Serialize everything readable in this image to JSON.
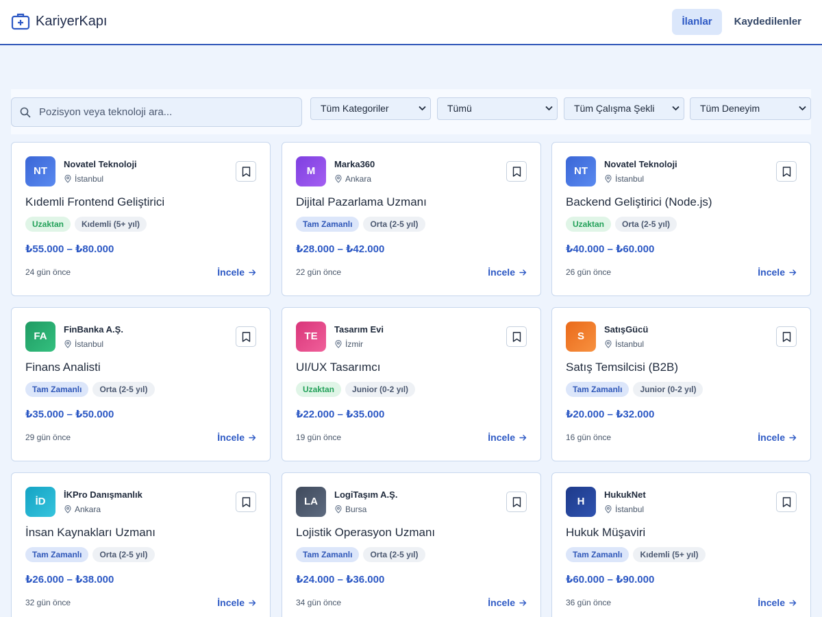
{
  "app": {
    "brand": "KariyerKapı",
    "nav": [
      {
        "label": "İlanlar",
        "active": true
      },
      {
        "label": "Kaydedilenler",
        "active": false
      }
    ]
  },
  "filters": {
    "search_placeholder": "Pozisyon veya teknoloji ara...",
    "search_value": "",
    "category": "Tüm Kategoriler",
    "type": "Tümü",
    "work_mode": "Tüm Çalışma Şekli",
    "experience": "Tüm Deneyim"
  },
  "jobs": [
    {
      "initials": "NT",
      "color": "#3a66d6",
      "color2": "#5a8af0",
      "company": "Novatel Teknoloji",
      "location": "İstanbul",
      "title": "Kıdemli Frontend Geliştirici",
      "tag1": "Uzaktan",
      "tag1_kind": "remote",
      "tag2": "Kıdemli (5+ yıl)",
      "salary": "₺55.000 – ₺80.000",
      "date": "24 gün önce",
      "action": "İncele"
    },
    {
      "initials": "M",
      "color": "#7e3fe0",
      "color2": "#a45ff2",
      "company": "Marka360",
      "location": "Ankara",
      "title": "Dijital Pazarlama Uzmanı",
      "tag1": "Tam Zamanlı",
      "tag1_kind": "full",
      "tag2": "Orta (2-5 yıl)",
      "salary": "₺28.000 – ₺42.000",
      "date": "22 gün önce",
      "action": "İncele"
    },
    {
      "initials": "NT",
      "color": "#3a66d6",
      "color2": "#5a8af0",
      "company": "Novatel Teknoloji",
      "location": "İstanbul",
      "title": "Backend Geliştirici (Node.js)",
      "tag1": "Uzaktan",
      "tag1_kind": "remote",
      "tag2": "Orta (2-5 yıl)",
      "salary": "₺40.000 – ₺60.000",
      "date": "26 gün önce",
      "action": "İncele"
    },
    {
      "initials": "FA",
      "color": "#1f9b63",
      "color2": "#34c07f",
      "company": "FinBanka A.Ş.",
      "location": "İstanbul",
      "title": "Finans Analisti",
      "tag1": "Tam Zamanlı",
      "tag1_kind": "full",
      "tag2": "Orta (2-5 yıl)",
      "salary": "₺35.000 – ₺50.000",
      "date": "29 gün önce",
      "action": "İncele"
    },
    {
      "initials": "TE",
      "color": "#d9357a",
      "color2": "#f0609a",
      "company": "Tasarım Evi",
      "location": "İzmir",
      "title": "UI/UX Tasarımcı",
      "tag1": "Uzaktan",
      "tag1_kind": "remote",
      "tag2": "Junior (0-2 yıl)",
      "salary": "₺22.000 – ₺35.000",
      "date": "19 gün önce",
      "action": "İncele"
    },
    {
      "initials": "S",
      "color": "#ea6a1a",
      "color2": "#f79140",
      "company": "SatışGücü",
      "location": "İstanbul",
      "title": "Satış Temsilcisi (B2B)",
      "tag1": "Tam Zamanlı",
      "tag1_kind": "full",
      "tag2": "Junior (0-2 yıl)",
      "salary": "₺20.000 – ₺32.000",
      "date": "16 gün önce",
      "action": "İncele"
    },
    {
      "initials": "İD",
      "color": "#14a3c4",
      "color2": "#36c4dd",
      "company": "İKPro Danışmanlık",
      "location": "Ankara",
      "title": "İnsan Kaynakları Uzmanı",
      "tag1": "Tam Zamanlı",
      "tag1_kind": "full",
      "tag2": "Orta (2-5 yıl)",
      "salary": "₺26.000 – ₺38.000",
      "date": "32 gün önce",
      "action": "İncele"
    },
    {
      "initials": "LA",
      "color": "#3f4a5c",
      "color2": "#5e6b80",
      "company": "LogiTaşım A.Ş.",
      "location": "Bursa",
      "title": "Lojistik Operasyon Uzmanı",
      "tag1": "Tam Zamanlı",
      "tag1_kind": "full",
      "tag2": "Orta (2-5 yıl)",
      "salary": "₺24.000 – ₺36.000",
      "date": "34 gün önce",
      "action": "İncele"
    },
    {
      "initials": "H",
      "color": "#1e3a8a",
      "color2": "#2f53b0",
      "company": "HukukNet",
      "location": "İstanbul",
      "title": "Hukuk Müşaviri",
      "tag1": "Tam Zamanlı",
      "tag1_kind": "full",
      "tag2": "Kıdemli (5+ yıl)",
      "salary": "₺60.000 – ₺90.000",
      "date": "36 gün önce",
      "action": "İncele"
    }
  ]
}
